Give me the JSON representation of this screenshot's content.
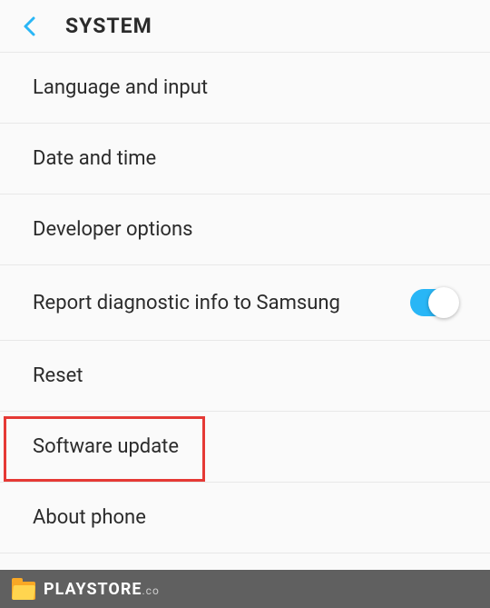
{
  "header": {
    "title": "SYSTEM"
  },
  "items": [
    {
      "label": "Language and input",
      "has_toggle": false
    },
    {
      "label": "Date and time",
      "has_toggle": false
    },
    {
      "label": "Developer options",
      "has_toggle": false
    },
    {
      "label": "Report diagnostic info to Samsung",
      "has_toggle": true,
      "toggle_on": true
    },
    {
      "label": "Reset",
      "has_toggle": false
    },
    {
      "label": "Software update",
      "has_toggle": false,
      "highlighted": true
    },
    {
      "label": "About phone",
      "has_toggle": false
    }
  ],
  "footer": {
    "brand": "PLAYSTORE",
    "suffix": ".co"
  },
  "colors": {
    "accent": "#29b6f6",
    "highlight": "#e53935",
    "footer_bg": "#606060"
  }
}
